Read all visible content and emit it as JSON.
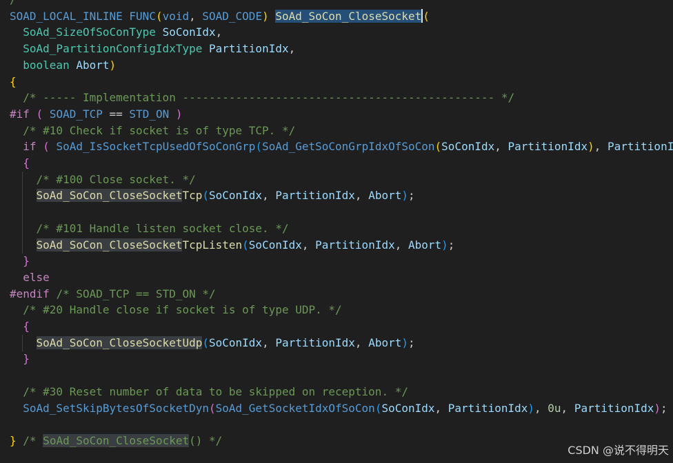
{
  "editor": {
    "background": "#1f1f1f",
    "lines": [
      {
        "top_line": true,
        "indent": 0,
        "guides": 0,
        "tokens": [
          {
            "t": "/",
            "c": "#6a9955"
          }
        ]
      },
      {
        "indent": 0,
        "guides": 0,
        "tokens": [
          {
            "t": "SOAD_LOCAL_INLINE",
            "c": "#569cd6"
          },
          {
            "t": " ",
            "c": "#cccccc"
          },
          {
            "t": "FUNC",
            "c": "#569cd6"
          },
          {
            "t": "(",
            "c": "#ffd700"
          },
          {
            "t": "void",
            "c": "#569cd6"
          },
          {
            "t": ", ",
            "c": "#cccccc"
          },
          {
            "t": "SOAD_CODE",
            "c": "#569cd6"
          },
          {
            "t": ")",
            "c": "#ffd700"
          },
          {
            "t": " ",
            "c": "#cccccc"
          },
          {
            "t": "SoAd_SoCon_CloseSocket",
            "c": "#dcdcaa",
            "bg": "sel",
            "cursor_after": true
          },
          {
            "t": "(",
            "c": "#ffd700"
          }
        ]
      },
      {
        "indent": 2,
        "guides": 0,
        "tokens": [
          {
            "t": "SoAd_SizeOfSoConType",
            "c": "#4ec9b0"
          },
          {
            "t": " ",
            "c": "#cccccc"
          },
          {
            "t": "SoConIdx",
            "c": "#9cdcfe"
          },
          {
            "t": ",",
            "c": "#cccccc"
          }
        ]
      },
      {
        "indent": 2,
        "guides": 0,
        "tokens": [
          {
            "t": "SoAd_PartitionConfigIdxType",
            "c": "#4ec9b0"
          },
          {
            "t": " ",
            "c": "#cccccc"
          },
          {
            "t": "PartitionIdx",
            "c": "#9cdcfe"
          },
          {
            "t": ",",
            "c": "#cccccc"
          }
        ]
      },
      {
        "indent": 2,
        "guides": 0,
        "tokens": [
          {
            "t": "boolean",
            "c": "#4ec9b0"
          },
          {
            "t": " ",
            "c": "#cccccc"
          },
          {
            "t": "Abort",
            "c": "#9cdcfe"
          },
          {
            "t": ")",
            "c": "#ffd700"
          }
        ]
      },
      {
        "indent": 0,
        "guides": 0,
        "tokens": [
          {
            "t": "{",
            "c": "#ffd700"
          }
        ]
      },
      {
        "indent": 2,
        "guides": 0,
        "tokens": [
          {
            "t": "/* ----- Implementation ----------------------------------------------- */",
            "c": "#6a9955"
          }
        ]
      },
      {
        "indent": 0,
        "guides": 0,
        "tokens": [
          {
            "t": "#if",
            "c": "#c586c0"
          },
          {
            "t": " ",
            "c": "#cccccc"
          },
          {
            "t": "(",
            "c": "#da70d6"
          },
          {
            "t": " ",
            "c": "#cccccc"
          },
          {
            "t": "SOAD_TCP",
            "c": "#569cd6"
          },
          {
            "t": " == ",
            "c": "#cccccc"
          },
          {
            "t": "STD_ON",
            "c": "#569cd6"
          },
          {
            "t": " ",
            "c": "#cccccc"
          },
          {
            "t": ")",
            "c": "#da70d6"
          }
        ]
      },
      {
        "indent": 2,
        "guides": 0,
        "tokens": [
          {
            "t": "/* #10 Check if socket is of type TCP. */",
            "c": "#6a9955"
          }
        ]
      },
      {
        "indent": 2,
        "guides": 0,
        "tokens": [
          {
            "t": "if",
            "c": "#c586c0"
          },
          {
            "t": " ",
            "c": "#cccccc"
          },
          {
            "t": "(",
            "c": "#da70d6"
          },
          {
            "t": " ",
            "c": "#cccccc"
          },
          {
            "t": "SoAd_IsSocketTcpUsedOfSoConGrp",
            "c": "#569cd6"
          },
          {
            "t": "(",
            "c": "#179fff"
          },
          {
            "t": "SoAd_GetSoConGrpIdxOfSoCon",
            "c": "#569cd6"
          },
          {
            "t": "(",
            "c": "#ffd700"
          },
          {
            "t": "SoConIdx",
            "c": "#9cdcfe"
          },
          {
            "t": ", ",
            "c": "#cccccc"
          },
          {
            "t": "PartitionIdx",
            "c": "#9cdcfe"
          },
          {
            "t": ")",
            "c": "#ffd700"
          },
          {
            "t": ", ",
            "c": "#cccccc"
          },
          {
            "t": "PartitionI",
            "c": "#9cdcfe"
          }
        ]
      },
      {
        "indent": 2,
        "guides": 0,
        "tokens": [
          {
            "t": "{",
            "c": "#da70d6"
          }
        ]
      },
      {
        "indent": 4,
        "guides": 1,
        "tokens": [
          {
            "t": "/* #100 Close socket. */",
            "c": "#6a9955"
          }
        ]
      },
      {
        "indent": 4,
        "guides": 1,
        "tokens": [
          {
            "t": "SoAd_SoCon_CloseSocket",
            "c": "#dcdcaa",
            "bg": "hl"
          },
          {
            "t": "Tcp",
            "c": "#dcdcaa"
          },
          {
            "t": "(",
            "c": "#179fff"
          },
          {
            "t": "SoConIdx",
            "c": "#9cdcfe"
          },
          {
            "t": ", ",
            "c": "#cccccc"
          },
          {
            "t": "PartitionIdx",
            "c": "#9cdcfe"
          },
          {
            "t": ", ",
            "c": "#cccccc"
          },
          {
            "t": "Abort",
            "c": "#9cdcfe"
          },
          {
            "t": ")",
            "c": "#179fff"
          },
          {
            "t": ";",
            "c": "#cccccc"
          }
        ]
      },
      {
        "indent": 0,
        "guides": 1,
        "tokens": []
      },
      {
        "indent": 4,
        "guides": 1,
        "tokens": [
          {
            "t": "/* #101 Handle listen socket close. */",
            "c": "#6a9955"
          }
        ]
      },
      {
        "indent": 4,
        "guides": 1,
        "tokens": [
          {
            "t": "SoAd_SoCon_CloseSocket",
            "c": "#dcdcaa",
            "bg": "hl"
          },
          {
            "t": "TcpListen",
            "c": "#dcdcaa"
          },
          {
            "t": "(",
            "c": "#179fff"
          },
          {
            "t": "SoConIdx",
            "c": "#9cdcfe"
          },
          {
            "t": ", ",
            "c": "#cccccc"
          },
          {
            "t": "PartitionIdx",
            "c": "#9cdcfe"
          },
          {
            "t": ", ",
            "c": "#cccccc"
          },
          {
            "t": "Abort",
            "c": "#9cdcfe"
          },
          {
            "t": ")",
            "c": "#179fff"
          },
          {
            "t": ";",
            "c": "#cccccc"
          }
        ]
      },
      {
        "indent": 2,
        "guides": 0,
        "tokens": [
          {
            "t": "}",
            "c": "#da70d6"
          }
        ]
      },
      {
        "indent": 2,
        "guides": 0,
        "tokens": [
          {
            "t": "else",
            "c": "#c586c0"
          }
        ]
      },
      {
        "indent": 0,
        "guides": 0,
        "tokens": [
          {
            "t": "#endif",
            "c": "#c586c0"
          },
          {
            "t": " ",
            "c": "#cccccc"
          },
          {
            "t": "/* SOAD_TCP == STD_ON */",
            "c": "#6a9955"
          }
        ]
      },
      {
        "indent": 2,
        "guides": 0,
        "tokens": [
          {
            "t": "/* #20 Handle close if socket is of type UDP. */",
            "c": "#6a9955"
          }
        ]
      },
      {
        "indent": 2,
        "guides": 0,
        "tokens": [
          {
            "t": "{",
            "c": "#da70d6"
          }
        ]
      },
      {
        "indent": 4,
        "guides": 1,
        "tokens": [
          {
            "t": "SoAd_SoCon_CloseSocketUdp",
            "c": "#dcdcaa",
            "bg": "hl"
          },
          {
            "t": "(",
            "c": "#179fff"
          },
          {
            "t": "SoConIdx",
            "c": "#9cdcfe"
          },
          {
            "t": ", ",
            "c": "#cccccc"
          },
          {
            "t": "PartitionIdx",
            "c": "#9cdcfe"
          },
          {
            "t": ", ",
            "c": "#cccccc"
          },
          {
            "t": "Abort",
            "c": "#9cdcfe"
          },
          {
            "t": ")",
            "c": "#179fff"
          },
          {
            "t": ";",
            "c": "#cccccc"
          }
        ]
      },
      {
        "indent": 2,
        "guides": 0,
        "tokens": [
          {
            "t": "}",
            "c": "#da70d6"
          }
        ]
      },
      {
        "indent": 0,
        "guides": 0,
        "tokens": []
      },
      {
        "indent": 2,
        "guides": 0,
        "tokens": [
          {
            "t": "/* #30 Reset number of data to be skipped on reception. */",
            "c": "#6a9955"
          }
        ]
      },
      {
        "indent": 2,
        "guides": 0,
        "tokens": [
          {
            "t": "SoAd_SetSkipBytesOfSocketDyn",
            "c": "#569cd6"
          },
          {
            "t": "(",
            "c": "#da70d6"
          },
          {
            "t": "SoAd_GetSocketIdxOfSoCon",
            "c": "#569cd6"
          },
          {
            "t": "(",
            "c": "#179fff"
          },
          {
            "t": "SoConIdx",
            "c": "#9cdcfe"
          },
          {
            "t": ", ",
            "c": "#cccccc"
          },
          {
            "t": "PartitionIdx",
            "c": "#9cdcfe"
          },
          {
            "t": ")",
            "c": "#179fff"
          },
          {
            "t": ", ",
            "c": "#cccccc"
          },
          {
            "t": "0u",
            "c": "#b5cea8"
          },
          {
            "t": ", ",
            "c": "#cccccc"
          },
          {
            "t": "PartitionIdx",
            "c": "#9cdcfe"
          },
          {
            "t": ")",
            "c": "#da70d6"
          },
          {
            "t": ";",
            "c": "#cccccc"
          }
        ]
      },
      {
        "indent": 0,
        "guides": 0,
        "tokens": []
      },
      {
        "indent": 0,
        "guides": 0,
        "tokens": [
          {
            "t": "}",
            "c": "#ffd700"
          },
          {
            "t": " ",
            "c": "#cccccc"
          },
          {
            "t": "/* ",
            "c": "#6a9955"
          },
          {
            "t": "SoAd_SoCon_CloseSocket",
            "c": "#6a9955",
            "bg": "hl"
          },
          {
            "t": "() */",
            "c": "#6a9955"
          }
        ]
      }
    ]
  },
  "watermark": "CSDN @说不得明天"
}
